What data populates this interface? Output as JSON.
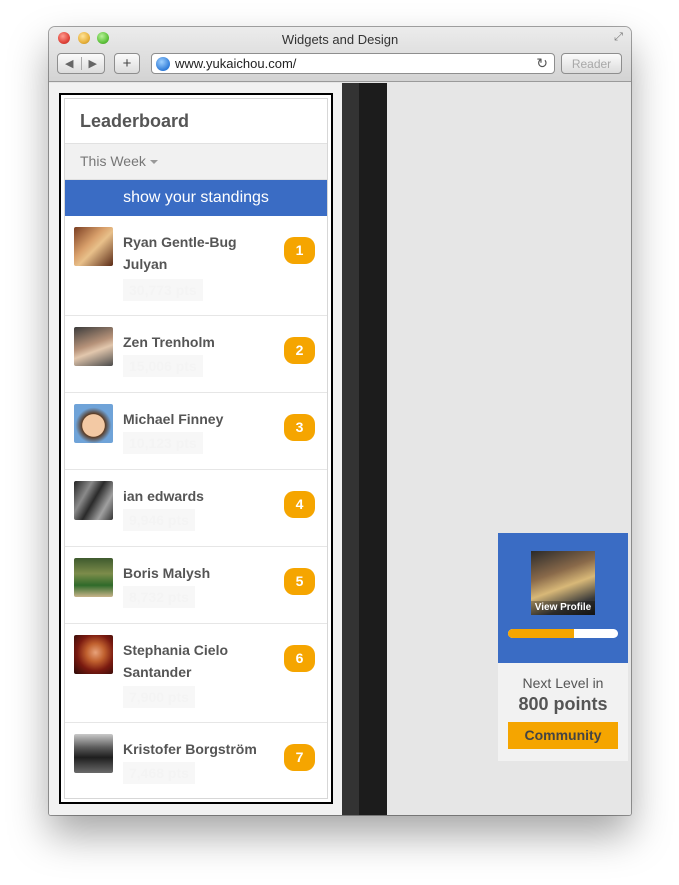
{
  "window": {
    "title": "Widgets and Design"
  },
  "toolbar": {
    "back_icon": "◀",
    "forward_icon": "▶",
    "add_label": "+",
    "url": "www.yukaichou.com/",
    "reader_label": "Reader"
  },
  "leaderboard": {
    "title": "Leaderboard",
    "period": "This Week",
    "standings_label": "show your standings",
    "rows": [
      {
        "name": "Ryan Gentle-Bug Julyan",
        "points": "30,773 pts",
        "rank": "1"
      },
      {
        "name": "Zen Trenholm",
        "points": "15,006 pts",
        "rank": "2"
      },
      {
        "name": "Michael Finney",
        "points": "10,123 pts",
        "rank": "3"
      },
      {
        "name": "ian edwards",
        "points": "9,946 pts",
        "rank": "4"
      },
      {
        "name": "Boris Malysh",
        "points": "8,732 pts",
        "rank": "5"
      },
      {
        "name": "Stephania Cielo Santander",
        "points": "7,900 pts",
        "rank": "6"
      },
      {
        "name": "Kristofer Borgström",
        "points": "7,468 pts",
        "rank": "7"
      }
    ]
  },
  "profile": {
    "view_profile_label": "View Profile",
    "progress_fraction": 0.6,
    "next_level_label": "Next Level in",
    "next_level_points": "800 points",
    "community_label": "Community"
  },
  "colors": {
    "accent_blue": "#3a6cc4",
    "accent_orange": "#f5a500"
  }
}
